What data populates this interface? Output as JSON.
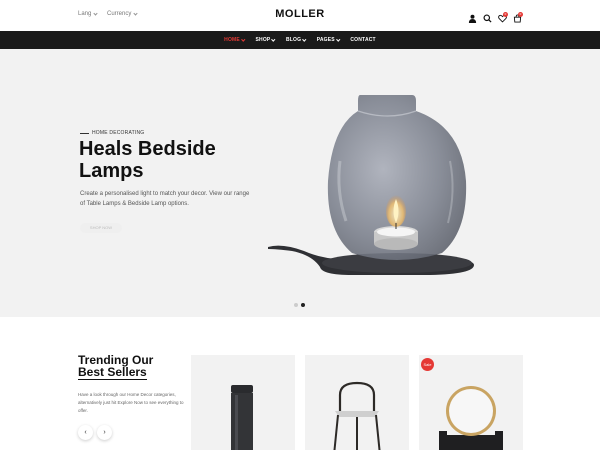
{
  "topbar": {
    "lang_label": "Lang",
    "currency_label": "Currency",
    "logo": "MOLLER",
    "icons": [
      "user-icon",
      "search-icon",
      "heart-icon",
      "cart-icon"
    ],
    "wishlist_count": "0",
    "cart_count": "0"
  },
  "nav": {
    "items": [
      {
        "label": "HOME",
        "active": true,
        "dropdown": true
      },
      {
        "label": "SHOP",
        "active": false,
        "dropdown": true
      },
      {
        "label": "BLOG",
        "active": false,
        "dropdown": true
      },
      {
        "label": "PAGES",
        "active": false,
        "dropdown": true
      },
      {
        "label": "CONTACT",
        "active": false,
        "dropdown": false
      }
    ]
  },
  "hero": {
    "eyebrow": "HOME DECORATING",
    "title_line1": "Heals Bedside",
    "title_line2": "Lamps",
    "description": "Create a personalised light to match your decor. View our range of Table Lamps & Bedside Lamp options.",
    "button_label": "SHOP NOW",
    "slide_count": 2,
    "active_slide": 2
  },
  "trending": {
    "title_line1": "Trending Our",
    "title_line2": "Best Sellers",
    "description": "Have a look through our Home Decor categories, alternatively just hit Explore Now to see everything to offer.",
    "prev_icon": "chevron-left-icon",
    "next_icon": "chevron-right-icon",
    "products": [
      {
        "image": "bottle",
        "sale": false
      },
      {
        "image": "chair",
        "sale": false
      },
      {
        "image": "mirror",
        "sale": true,
        "sale_label": "Sale"
      }
    ]
  },
  "colors": {
    "accent": "#e53935",
    "nav_bg": "#1a1a1a",
    "hero_bg": "#f2f2f2"
  }
}
